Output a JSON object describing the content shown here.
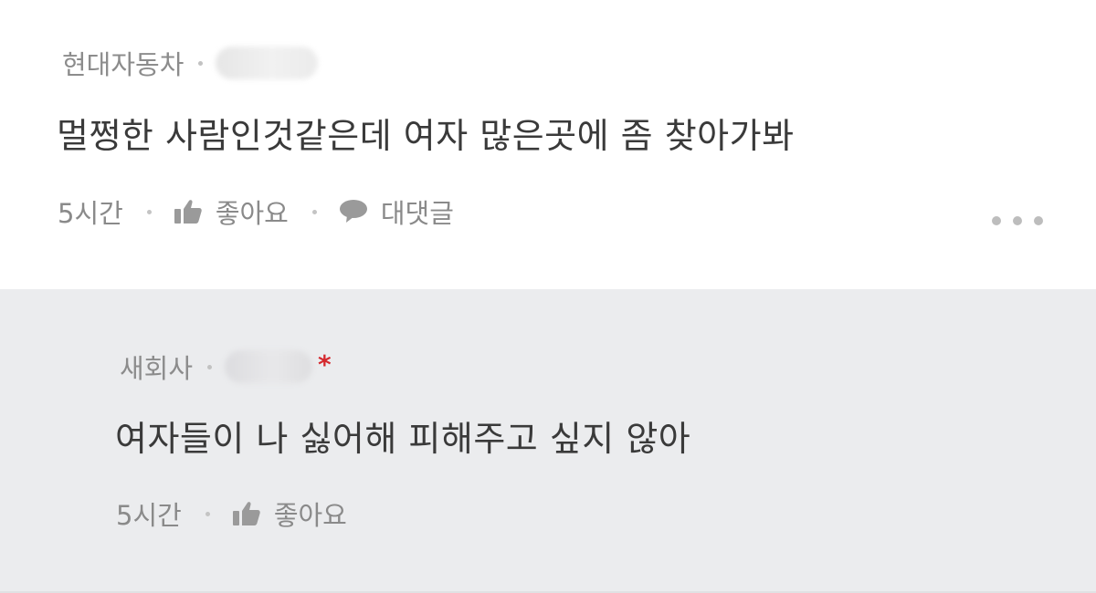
{
  "comment": {
    "author": "현대자동차",
    "text": "멀쩡한 사람인것같은데 여자 많은곳에 좀 찾아가봐",
    "time": "5시간",
    "like_label": "좋아요",
    "reply_label": "대댓글",
    "icons": {
      "like": "thumbs-up-icon",
      "reply": "speech-bubble-icon",
      "more": "more-dots-icon"
    }
  },
  "reply": {
    "author": "새회사",
    "mark": "*",
    "text": "여자들이 나 싫어해 피해주고 싶지 않아",
    "time": "5시간",
    "like_label": "좋아요"
  },
  "colors": {
    "reply_background": "#ebecee",
    "author_mark": "#d4282d",
    "meta_text": "#8c8c8c",
    "body_text": "#3a3a3a"
  }
}
